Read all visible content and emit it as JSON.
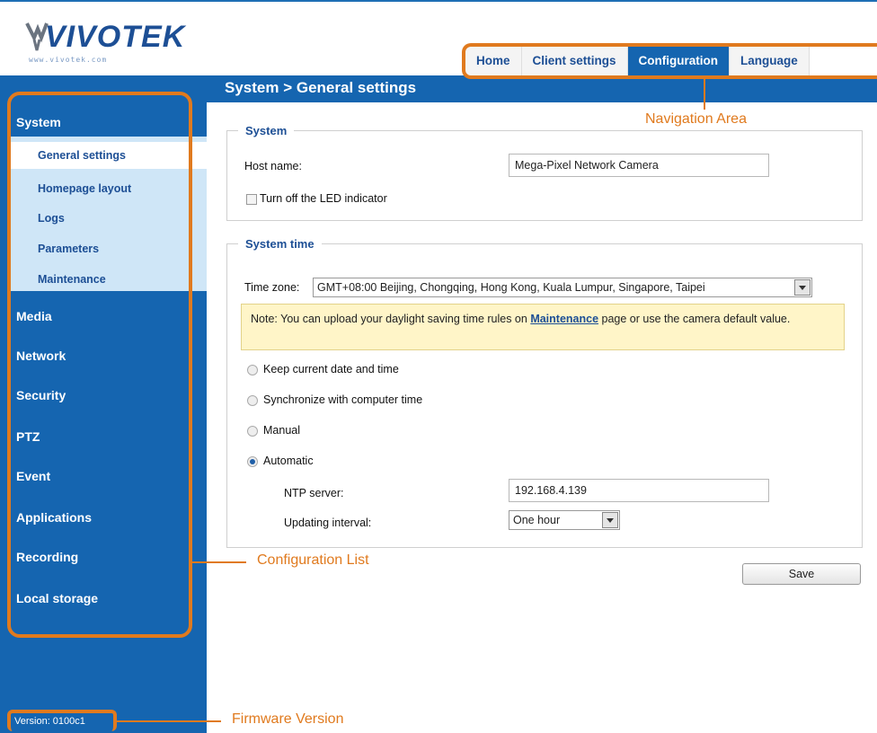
{
  "brand": {
    "logo_text": "VIVOTEK",
    "logo_sub": "www.vivotek.com"
  },
  "nav": {
    "items": [
      "Home",
      "Client settings",
      "Configuration",
      "Language"
    ],
    "active": "Configuration"
  },
  "breadcrumb": "System  > General settings",
  "sidebar": {
    "system": "System",
    "system_items": [
      "General settings",
      "Homepage layout",
      "Logs",
      "Parameters",
      "Maintenance"
    ],
    "active_item": "General settings",
    "sections": [
      "Media",
      "Network",
      "Security",
      "PTZ",
      "Event",
      "Applications",
      "Recording",
      "Local storage"
    ],
    "version": "Version: 0100c1"
  },
  "system_group": {
    "legend": "System",
    "host_label": "Host name:",
    "host_value": "Mega-Pixel Network Camera",
    "led_label": "Turn off the LED indicator"
  },
  "time_group": {
    "legend": "System time",
    "tz_label": "Time zone:",
    "tz_value": "GMT+08:00 Beijing, Chongqing, Hong Kong, Kuala Lumpur, Singapore, Taipei",
    "note_prefix": "Note: You can upload your daylight saving time rules on ",
    "note_link": "Maintenance",
    "note_suffix": " page or use the camera default value.",
    "options": [
      "Keep current date and time",
      "Synchronize with computer time",
      "Manual",
      "Automatic"
    ],
    "selected_option": "Automatic",
    "ntp_label": "NTP server:",
    "ntp_value": "192.168.4.139",
    "interval_label": "Updating interval:",
    "interval_value": "One hour"
  },
  "save_label": "Save",
  "annotations": {
    "navigation": "Navigation Area",
    "config_list": "Configuration List",
    "firmware": "Firmware Version"
  },
  "colors": {
    "primary_blue": "#1565b0",
    "callout_orange": "#e07a1e",
    "note_bg": "#fff5c8"
  }
}
